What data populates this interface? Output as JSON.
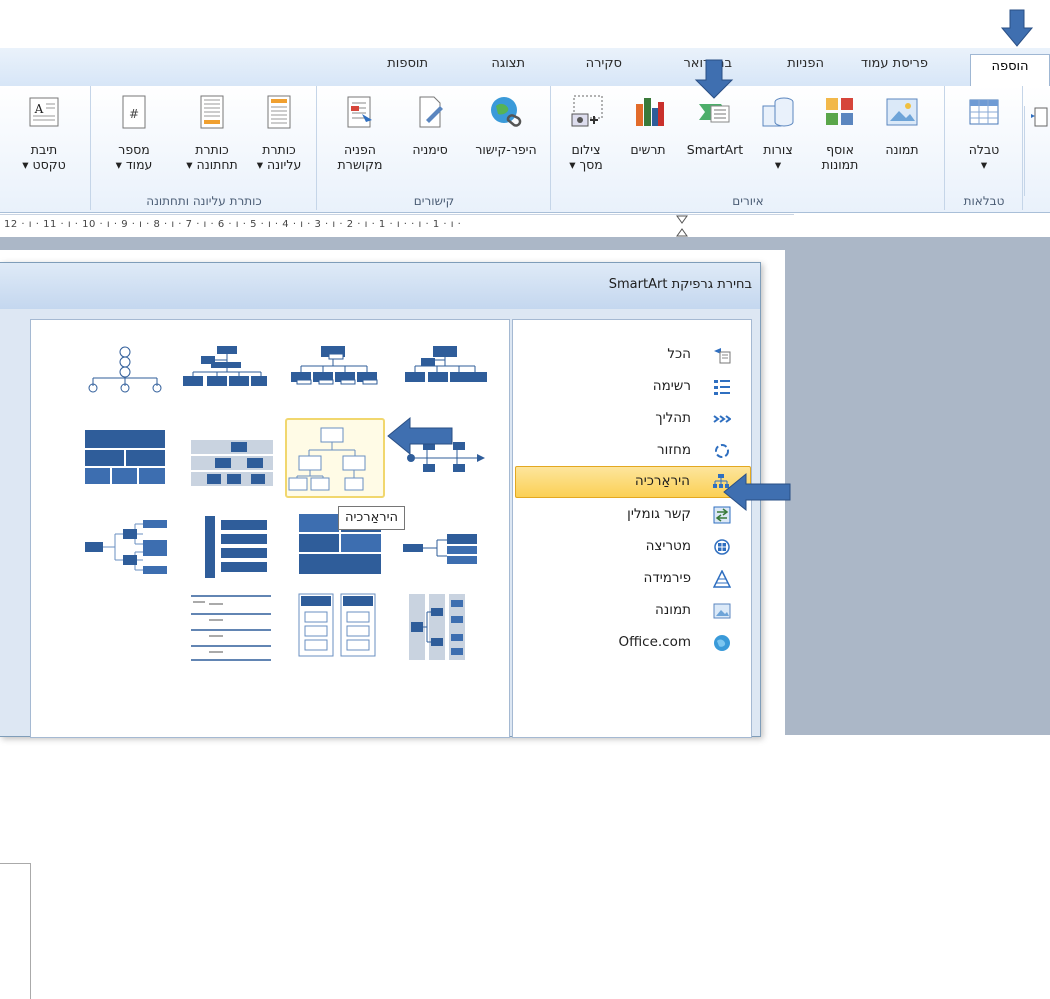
{
  "tabs": [
    {
      "id": "insert",
      "label": "הוספה",
      "active": true
    },
    {
      "id": "page_layout",
      "label": "פריסת עמוד"
    },
    {
      "id": "references",
      "label": "הפניות"
    },
    {
      "id": "mailings",
      "label": "ברי דואר"
    },
    {
      "id": "review",
      "label": "סקירה"
    },
    {
      "id": "view",
      "label": "תצוגה"
    },
    {
      "id": "addins",
      "label": "תוספות"
    }
  ],
  "groups": {
    "tables": {
      "label": "טבלאות",
      "buttons": [
        {
          "label": "טבלה",
          "sub": "▾"
        }
      ]
    },
    "illustrations": {
      "label": "איורים",
      "buttons": [
        {
          "label": "תמונה",
          "sub": ""
        },
        {
          "label": "אוסף",
          "sub": "תמונות"
        },
        {
          "label": "צורות",
          "sub": "▾"
        },
        {
          "label": "SmartArt",
          "sub": ""
        },
        {
          "label": "תרשים",
          "sub": ""
        },
        {
          "label": "צילום",
          "sub": "מסך ▾"
        }
      ]
    },
    "links": {
      "label": "קישורים",
      "buttons": [
        {
          "label": "היפר-קישור",
          "sub": ""
        },
        {
          "label": "סימניה",
          "sub": ""
        },
        {
          "label": "הפניה",
          "sub": "מקושרת"
        }
      ]
    },
    "header_footer": {
      "label": "כותרת עליונה ותחתונה",
      "buttons": [
        {
          "label": "כותרת",
          "sub": "עליונה ▾"
        },
        {
          "label": "כותרת",
          "sub": "תחתונה ▾"
        },
        {
          "label": "מספר",
          "sub": "עמוד ▾"
        }
      ]
    },
    "text": {
      "label": "",
      "buttons": [
        {
          "label": "תיבת",
          "sub": "טקסט ▾"
        }
      ]
    }
  },
  "ruler": {
    "text": "12 · ı · 11 · ı · 10 · ı · 9 · ı · 8 · ı · 7 · ı · 6 · ı · 5 · ı · 4 · ı · 3 · ı · 2 · ı · 1 · ı ·   · ı · 1 · ı ·"
  },
  "dialog": {
    "title": "בחירת גרפיקת SmartArt",
    "categories": [
      {
        "label": "הכל",
        "icon": "all-icon"
      },
      {
        "label": "רשימה",
        "icon": "list-icon"
      },
      {
        "label": "תהליך",
        "icon": "process-icon"
      },
      {
        "label": "מחזור",
        "icon": "cycle-icon"
      },
      {
        "label": "היראַרכיה",
        "icon": "hierarchy-icon",
        "selected": true
      },
      {
        "label": "קשר גומלין",
        "icon": "relationship-icon"
      },
      {
        "label": "מטריצה",
        "icon": "matrix-icon"
      },
      {
        "label": "פירמידה",
        "icon": "pyramid-icon"
      },
      {
        "label": "תמונה",
        "icon": "picture-icon"
      },
      {
        "label": "Office.com",
        "icon": "office-com-icon"
      }
    ],
    "tooltip": "היראַרכיה",
    "layouts": [
      {
        "row": 0,
        "col": 0,
        "style": "org-chart"
      },
      {
        "row": 0,
        "col": 1,
        "style": "name-title-org"
      },
      {
        "row": 0,
        "col": 2,
        "style": "half-circle-org"
      },
      {
        "row": 0,
        "col": 3,
        "style": "circle-picture"
      },
      {
        "row": 1,
        "col": 0,
        "style": "hierarchy",
        "selected": true
      },
      {
        "row": 1,
        "col": 1,
        "style": "labeled-hierarchy"
      },
      {
        "row": 1,
        "col": 2,
        "style": "table-hierarchy"
      },
      {
        "row": 1,
        "col": 3,
        "style": "block-stack"
      },
      {
        "row": 2,
        "col": 0,
        "style": "horizontal-hierarchy"
      },
      {
        "row": 2,
        "col": 1,
        "style": "stacked-blocks"
      },
      {
        "row": 2,
        "col": 2,
        "style": "bracket-list"
      },
      {
        "row": 2,
        "col": 3,
        "style": "horizontal-org"
      },
      {
        "row": 3,
        "col": 0,
        "style": "horizontal-labeled"
      },
      {
        "row": 3,
        "col": 1,
        "style": "hierarchy-list"
      },
      {
        "row": 3,
        "col": 2,
        "style": "lined-list"
      }
    ]
  },
  "colors": {
    "accent": "#2f5d9a",
    "arrow": "#3f6fb0",
    "selection": "#fbd055"
  }
}
